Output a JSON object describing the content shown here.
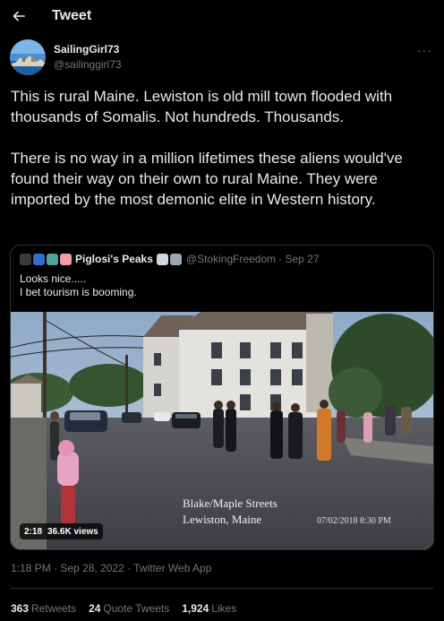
{
  "header": {
    "title": "Tweet",
    "back_icon": "arrow-left-icon"
  },
  "author": {
    "name": "SailingGirl73",
    "handle": "@sailinggirl73",
    "more_icon": "more-horizontal-icon",
    "more_label": "···"
  },
  "tweet": {
    "paragraphs": [
      "This is rural Maine. Lewiston is old mill town flooded with thousands of Somalis. Not hundreds. Thousands.",
      "There is no way in a million lifetimes these aliens would've found their way on their own to rural Maine. They were imported by the most demonic elite in Western history."
    ]
  },
  "quote": {
    "name": "Piglosi's Peaks",
    "handle": "@StokingFreedom",
    "date": "· Sep 27",
    "lines": [
      "Looks nice.....",
      "I bet tourism is booming."
    ],
    "media": {
      "caption_line1": "Blake/Maple Streets",
      "caption_line2": "Lewiston, Maine",
      "timestamp": "07/02/2018    8:30 PM",
      "duration": "2:18",
      "views": "36.6K views"
    }
  },
  "meta": {
    "time": "1:18 PM",
    "date": "· Sep 28, 2022 ·",
    "client": "Twitter Web App"
  },
  "stats": {
    "retweets_count": "363",
    "retweets_label": "Retweets",
    "quotes_count": "24",
    "quotes_label": "Quote Tweets",
    "likes_count": "1,924",
    "likes_label": "Likes"
  },
  "colors": {
    "background": "#000000",
    "text": "#e7e9ea",
    "secondary": "#71767b",
    "border": "#2f3336"
  }
}
